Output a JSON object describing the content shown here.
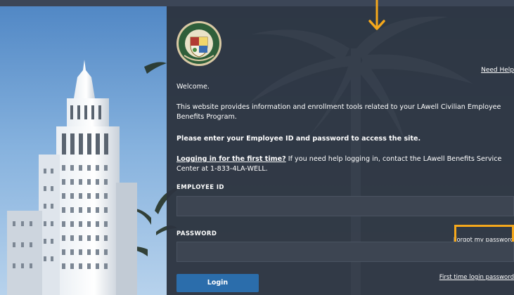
{
  "header": {
    "need_help": "Need Help"
  },
  "content": {
    "welcome": "Welcome.",
    "intro": "This website provides information and enrollment tools related to your LAwell Civilian Employee Benefits Program.",
    "instruction": "Please enter your Employee ID and password to access the site.",
    "first_time_link": "Logging in for the first time?",
    "help_text": " If you need help logging in, contact the LAwell Benefits Service Center at 1-833-4LA-WELL."
  },
  "form": {
    "employee_id_label": "EMPLOYEE ID",
    "employee_id_value": "",
    "password_label": "PASSWORD",
    "password_value": "",
    "forgot_password": "Forgot my password",
    "login_button": "Login",
    "first_time_password": "First time login password"
  },
  "colors": {
    "panel": "#2d3440",
    "button": "#2b6dab",
    "highlight": "#f5a81c"
  }
}
